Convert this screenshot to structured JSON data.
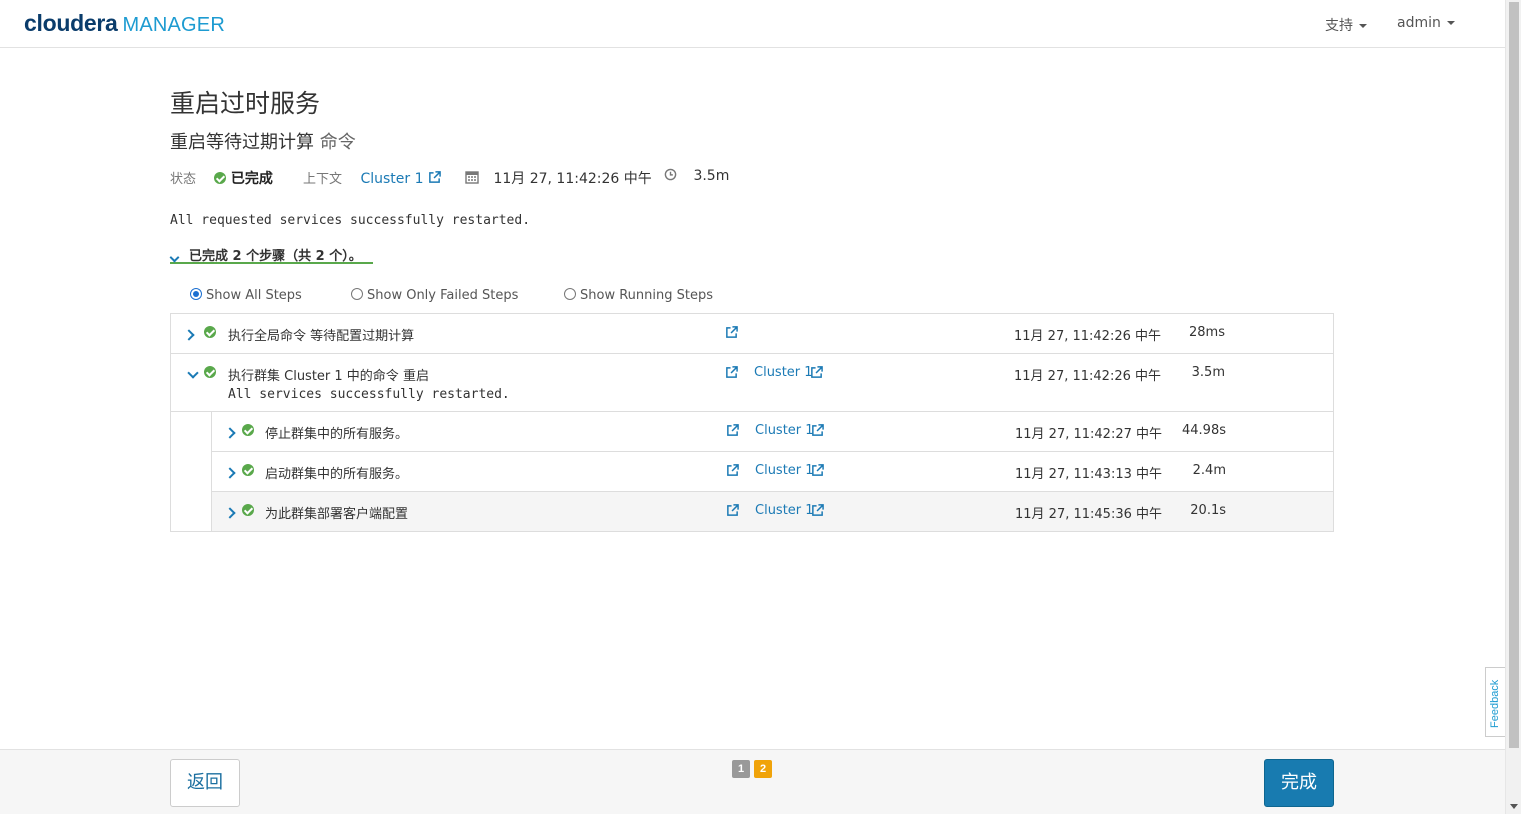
{
  "header": {
    "brand": "cloudera",
    "product": "MANAGER",
    "support_label": "支持",
    "user_label": "admin"
  },
  "page": {
    "title": "重启过时服务",
    "subtitle_main": "重启等待过期计算",
    "subtitle_suffix": "命令"
  },
  "meta": {
    "status_label": "状态",
    "status_value": "已完成",
    "context_label": "上下文",
    "context_value": "Cluster 1",
    "date": "11月 27, 11:42:26 中午",
    "duration": "3.5m"
  },
  "summary_message": "All requested services successfully restarted.",
  "steps_toggle": "已完成 2 个步骤（共 2 个）。",
  "filters": [
    {
      "label": "Show All Steps",
      "selected": true
    },
    {
      "label": "Show Only Failed Steps",
      "selected": false
    },
    {
      "label": "Show Running Steps",
      "selected": false
    }
  ],
  "steps": [
    {
      "name": "执行全局命令 等待配置过期计算",
      "context": "",
      "time": "11月 27, 11:42:26 中午",
      "duration": "28ms",
      "expanded": false
    },
    {
      "name": "执行群集 Cluster 1 中的命令 重启",
      "message": "All services successfully restarted.",
      "context": "Cluster 1",
      "time": "11月 27, 11:42:26 中午",
      "duration": "3.5m",
      "expanded": true
    },
    {
      "name": "停止群集中的所有服务。",
      "context": "Cluster 1",
      "time": "11月 27, 11:42:27 中午",
      "duration": "44.98s",
      "expanded": false
    },
    {
      "name": "启动群集中的所有服务。",
      "context": "Cluster 1",
      "time": "11月 27, 11:43:13 中午",
      "duration": "2.4m",
      "expanded": false
    },
    {
      "name": "为此群集部署客户端配置",
      "context": "Cluster 1",
      "time": "11月 27, 11:45:36 中午",
      "duration": "20.1s",
      "expanded": false
    }
  ],
  "footer": {
    "back_label": "返回",
    "done_label": "完成",
    "pages": [
      "1",
      "2"
    ]
  },
  "feedback_label": "Feedback",
  "colors": {
    "brand_dark": "#0a3c6b",
    "brand_light": "#1d9bd1",
    "link": "#1b7ab5",
    "success": "#59a84b",
    "primary_button": "#187bb0",
    "active_page": "#f0a30a"
  }
}
